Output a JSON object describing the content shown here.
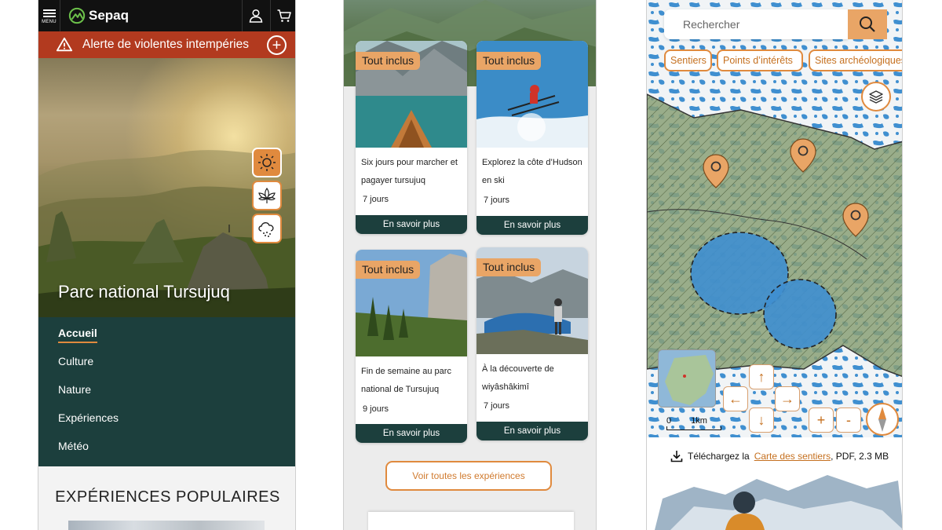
{
  "phone1": {
    "menu_label": "MENU",
    "brand": "Sepaq",
    "alert_text": "Alerte de violentes intempéries",
    "park_title": "Parc national Tursujuq",
    "weather_buttons": [
      "sun-icon",
      "leaf-icon",
      "cloud-snow-icon"
    ],
    "nav_items": [
      "Accueil",
      "Culture",
      "Nature",
      "Expériences",
      "Météo"
    ],
    "active_nav": "Accueil",
    "popular_heading": "EXPÉRIENCES POPULAIRES",
    "colors": {
      "brand_green": "#1c3f3d",
      "accent_orange": "#e08a3e",
      "alert_red": "#b23a1f",
      "topbar": "#111111"
    }
  },
  "phone2": {
    "cards": [
      {
        "badge": "Tout inclus",
        "title": "Six jours pour marcher et pagayer tursujuq",
        "days": "7 jours",
        "cta": "En savoir plus"
      },
      {
        "badge": "Tout inclus",
        "title": "Explorez la côte d’Hudson en ski",
        "days": "7 jours",
        "cta": "En savoir plus"
      },
      {
        "badge": "Tout inclus",
        "title": "Fin de semaine au parc national de Tursujuq",
        "days": "9 jours",
        "cta": "En savoir plus"
      },
      {
        "badge": "Tout inclus",
        "title": "À la découverte de wiyâshâkimî",
        "days": "7 jours",
        "cta": "En savoir plus"
      }
    ],
    "view_all": "Voir toutes les expériences"
  },
  "phone3": {
    "search_placeholder": "Rechercher",
    "chips": [
      "Sentiers",
      "Points d’intérêts",
      "Sites archéologiques"
    ],
    "scale_start": "0",
    "scale_end": "1km",
    "zoom_in": "+",
    "zoom_out": "-",
    "download_prefix": "Téléchargez la",
    "download_link": "Carte des sentiers",
    "download_suffix": ", PDF, 2.3 MB"
  }
}
